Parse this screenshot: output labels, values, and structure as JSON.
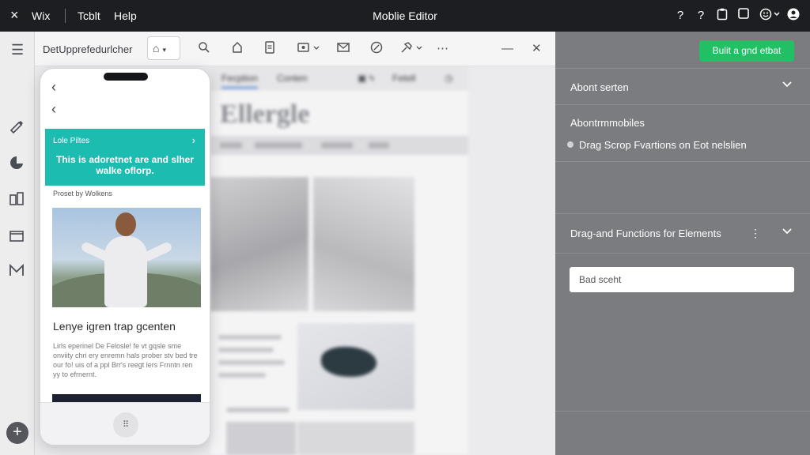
{
  "topbar": {
    "close_icon": "×",
    "brand": "Wix",
    "menu": [
      "Tcblt",
      "Help"
    ],
    "title": "Moblie Editor"
  },
  "toolbar": {
    "document_name": "DetUpprefedurlcher"
  },
  "canvas": {
    "page_tabs": [
      "Fecption",
      "Conten",
      "Fetell"
    ],
    "page_title": "Ellergle"
  },
  "phone": {
    "banner_label": "Lole Piltes",
    "banner_message": "This is adoretnet are and slher walke oflorp.",
    "posted_by": "Proset by Wolkens",
    "article_heading": "Lenye igren trap gcenten",
    "article_text": "Lirls eperinel De Felosle! fe vt gqsle sme onviity chri ery enremn hals prober stv bed tre our fo! uis of a ppl Brr's reegt lers Frnntn ren yy to efrnernt."
  },
  "right_panel": {
    "cta_label": "Bulit a gnd etbat",
    "sections": [
      {
        "label": "Abont serten"
      },
      {
        "label": "Abontrmmobiles"
      },
      {
        "label": "Drag Scrop Fvartions on Eot nelslien"
      },
      {
        "label": "Drag-and Functions for Elements"
      }
    ],
    "field_placeholder": "Bad sceht"
  },
  "colors": {
    "cta_green": "#21c064",
    "banner_teal": "#1dbcb1",
    "topbar": "#1d1e22",
    "panel_gray": "#7b7c80"
  },
  "icons": [
    "close-icon",
    "help-icon",
    "info-icon",
    "clipboard-icon",
    "square-icon",
    "smiley-icon",
    "user-icon",
    "hamburger-icon",
    "home-icon",
    "search-icon",
    "page-icon",
    "doc-icon",
    "media-icon",
    "mail-icon",
    "compass-icon",
    "pin-icon",
    "more-icon",
    "minimize-icon",
    "close-editor-icon",
    "brush-icon",
    "theme-icon",
    "apps-icon",
    "folder-icon",
    "blog-icon",
    "add-icon",
    "chevron-down-icon"
  ]
}
